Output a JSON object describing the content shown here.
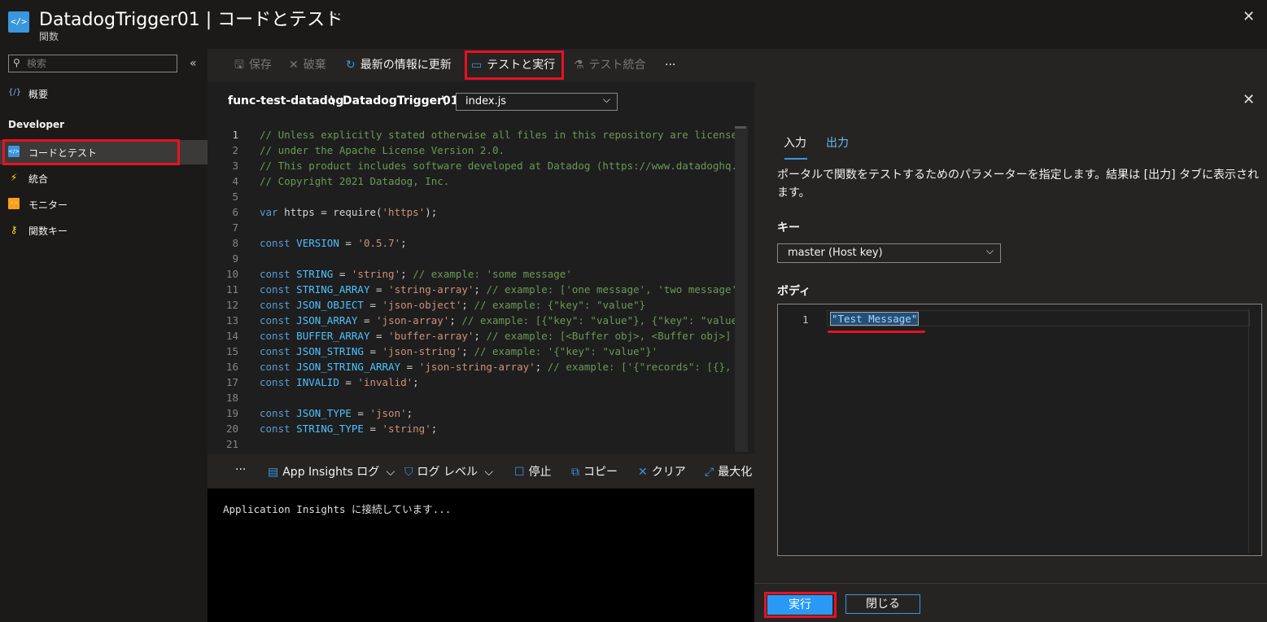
{
  "header": {
    "title": "DatadogTrigger01 | コードとテスト",
    "subtitle": "関数",
    "more": "···",
    "app_icon": "</>"
  },
  "sidebar": {
    "search_placeholder": "検索",
    "collapse_glyph": "«",
    "overview": {
      "icon": "{/}",
      "label": "概要"
    },
    "section": "Developer",
    "items": [
      {
        "icon": "code-test-icon",
        "label": "コードとテスト",
        "active": true
      },
      {
        "icon": "lightning-icon",
        "label": "統合"
      },
      {
        "icon": "monitor-icon",
        "label": "モニター"
      },
      {
        "icon": "key-icon",
        "label": "関数キー"
      }
    ]
  },
  "toolbar": {
    "save": "保存",
    "discard": "破棄",
    "refresh": "最新の情報に更新",
    "test_run": "テストと実行",
    "test_integration": "テスト統合",
    "more": "···"
  },
  "editor": {
    "breadcrumb": [
      "func-test-datadog",
      "\\",
      "DatadogTrigger01",
      "\\"
    ],
    "file": "index.js",
    "lines": [
      {
        "n": "1",
        "parts": [
          [
            "c-comment",
            "// Unless explicitly stated otherwise all files in this repository are license"
          ]
        ]
      },
      {
        "n": "2",
        "parts": [
          [
            "c-comment",
            "// under the Apache License Version 2.0."
          ]
        ]
      },
      {
        "n": "3",
        "parts": [
          [
            "c-comment",
            "// This product includes software developed at Datadog (https://www.datadoghq."
          ]
        ]
      },
      {
        "n": "4",
        "parts": [
          [
            "c-comment",
            "// Copyright 2021 Datadog, Inc."
          ]
        ]
      },
      {
        "n": "5",
        "parts": []
      },
      {
        "n": "6",
        "parts": [
          [
            "c-kw",
            "var"
          ],
          [
            "c-plain",
            " https = require("
          ],
          [
            "c-str",
            "'https'"
          ],
          [
            "c-plain",
            ");"
          ]
        ]
      },
      {
        "n": "7",
        "parts": []
      },
      {
        "n": "8",
        "parts": [
          [
            "c-kw",
            "const"
          ],
          [
            "c-id",
            " VERSION"
          ],
          [
            "c-plain",
            " = "
          ],
          [
            "c-str",
            "'0.5.7'"
          ],
          [
            "c-plain",
            ";"
          ]
        ]
      },
      {
        "n": "9",
        "parts": []
      },
      {
        "n": "10",
        "parts": [
          [
            "c-kw",
            "const"
          ],
          [
            "c-id",
            " STRING"
          ],
          [
            "c-plain",
            " = "
          ],
          [
            "c-str",
            "'string'"
          ],
          [
            "c-plain",
            "; "
          ],
          [
            "c-comment",
            "// example: 'some message'"
          ]
        ]
      },
      {
        "n": "11",
        "parts": [
          [
            "c-kw",
            "const"
          ],
          [
            "c-id",
            " STRING_ARRAY"
          ],
          [
            "c-plain",
            " = "
          ],
          [
            "c-str",
            "'string-array'"
          ],
          [
            "c-plain",
            "; "
          ],
          [
            "c-comment",
            "// example: ['one message', 'two message'"
          ]
        ]
      },
      {
        "n": "12",
        "parts": [
          [
            "c-kw",
            "const"
          ],
          [
            "c-id",
            " JSON_OBJECT"
          ],
          [
            "c-plain",
            " = "
          ],
          [
            "c-str",
            "'json-object'"
          ],
          [
            "c-plain",
            "; "
          ],
          [
            "c-comment",
            "// example: {\"key\": \"value\"}"
          ]
        ]
      },
      {
        "n": "13",
        "parts": [
          [
            "c-kw",
            "const"
          ],
          [
            "c-id",
            " JSON_ARRAY"
          ],
          [
            "c-plain",
            " = "
          ],
          [
            "c-str",
            "'json-array'"
          ],
          [
            "c-plain",
            "; "
          ],
          [
            "c-comment",
            "// example: [{\"key\": \"value\"}, {\"key\": \"value"
          ]
        ]
      },
      {
        "n": "14",
        "parts": [
          [
            "c-kw",
            "const"
          ],
          [
            "c-id",
            " BUFFER_ARRAY"
          ],
          [
            "c-plain",
            " = "
          ],
          [
            "c-str",
            "'buffer-array'"
          ],
          [
            "c-plain",
            "; "
          ],
          [
            "c-comment",
            "// example: [<Buffer obj>, <Buffer obj>]"
          ]
        ]
      },
      {
        "n": "15",
        "parts": [
          [
            "c-kw",
            "const"
          ],
          [
            "c-id",
            " JSON_STRING"
          ],
          [
            "c-plain",
            " = "
          ],
          [
            "c-str",
            "'json-string'"
          ],
          [
            "c-plain",
            "; "
          ],
          [
            "c-comment",
            "// example: '{\"key\": \"value\"}'"
          ]
        ]
      },
      {
        "n": "16",
        "parts": [
          [
            "c-kw",
            "const"
          ],
          [
            "c-id",
            " JSON_STRING_ARRAY"
          ],
          [
            "c-plain",
            " = "
          ],
          [
            "c-str",
            "'json-string-array'"
          ],
          [
            "c-plain",
            "; "
          ],
          [
            "c-comment",
            "// example: ['{\"records\": [{}, "
          ]
        ]
      },
      {
        "n": "17",
        "parts": [
          [
            "c-kw",
            "const"
          ],
          [
            "c-id",
            " INVALID"
          ],
          [
            "c-plain",
            " = "
          ],
          [
            "c-str",
            "'invalid'"
          ],
          [
            "c-plain",
            ";"
          ]
        ]
      },
      {
        "n": "18",
        "parts": []
      },
      {
        "n": "19",
        "parts": [
          [
            "c-kw",
            "const"
          ],
          [
            "c-id",
            " JSON_TYPE"
          ],
          [
            "c-plain",
            " = "
          ],
          [
            "c-str",
            "'json'"
          ],
          [
            "c-plain",
            ";"
          ]
        ]
      },
      {
        "n": "20",
        "parts": [
          [
            "c-kw",
            "const"
          ],
          [
            "c-id",
            " STRING_TYPE"
          ],
          [
            "c-plain",
            " = "
          ],
          [
            "c-str",
            "'string'"
          ],
          [
            "c-plain",
            ";"
          ]
        ]
      },
      {
        "n": "21",
        "parts": []
      }
    ]
  },
  "logbar": {
    "more": "···",
    "app_insights": "App Insights ログ",
    "log_level": "ログ レベル",
    "stop": "停止",
    "copy": "コピー",
    "clear": "クリア",
    "maximize": "最大化"
  },
  "console": {
    "text": "Application Insights に接続しています..."
  },
  "panel": {
    "tabs": [
      "入力",
      "出力"
    ],
    "description": "ポータルで関数をテストするためのパラメーターを指定します。結果は [出力] タブに表示されます。",
    "key_label": "キー",
    "key_value": "master (Host key)",
    "body_label": "ボディ",
    "body_line_number": "1",
    "body_text": "\"Test Message\"",
    "run": "実行",
    "close": "閉じる"
  }
}
